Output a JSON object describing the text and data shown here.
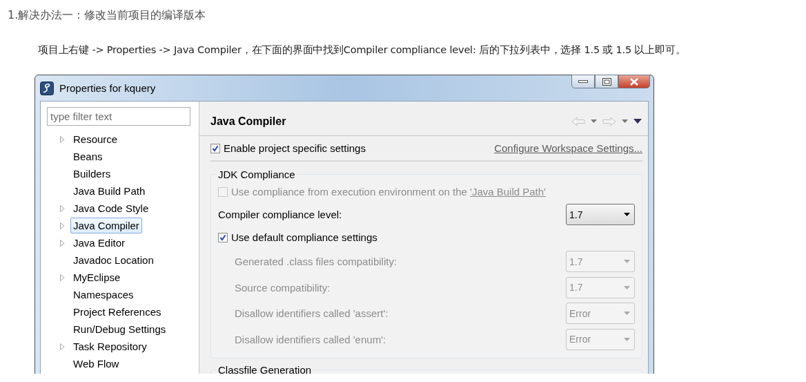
{
  "article": {
    "heading": "1.解决办法一：修改当前项目的编译版本",
    "paragraph": "项目上右键 -> Properties -> Java Compiler，在下面的界面中找到Compiler compliance level: 后的下拉列表中，选择 1.5 或 1.5 以上即可。"
  },
  "dialog": {
    "title": "Properties for kquery",
    "filter": {
      "placeholder": "type filter text"
    },
    "tree": [
      {
        "label": "Resource",
        "expandable": true,
        "selected": false
      },
      {
        "label": "Beans",
        "expandable": false,
        "selected": false
      },
      {
        "label": "Builders",
        "expandable": false,
        "selected": false
      },
      {
        "label": "Java Build Path",
        "expandable": false,
        "selected": false
      },
      {
        "label": "Java Code Style",
        "expandable": true,
        "selected": false
      },
      {
        "label": "Java Compiler",
        "expandable": true,
        "selected": true
      },
      {
        "label": "Java Editor",
        "expandable": true,
        "selected": false
      },
      {
        "label": "Javadoc Location",
        "expandable": false,
        "selected": false
      },
      {
        "label": "MyEclipse",
        "expandable": true,
        "selected": false
      },
      {
        "label": "Namespaces",
        "expandable": false,
        "selected": false
      },
      {
        "label": "Project References",
        "expandable": false,
        "selected": false
      },
      {
        "label": "Run/Debug Settings",
        "expandable": false,
        "selected": false
      },
      {
        "label": "Task Repository",
        "expandable": true,
        "selected": false
      },
      {
        "label": "Web Flow",
        "expandable": false,
        "selected": false
      }
    ],
    "page_title": "Java Compiler",
    "enable_specific": {
      "label": "Enable project specific settings",
      "checked": true
    },
    "workspace_link": "Configure Workspace Settings...",
    "jdk_group": {
      "title": "JDK Compliance",
      "use_ee": {
        "label": "Use compliance from execution environment on the",
        "link": "'Java Build Path'",
        "checked": false,
        "disabled": true
      },
      "compliance_level": {
        "label": "Compiler compliance level:",
        "value": "1.7"
      },
      "use_default": {
        "label": "Use default compliance settings",
        "checked": true
      },
      "settings": [
        {
          "label": "Generated .class files compatibility:",
          "value": "1.7",
          "disabled": true
        },
        {
          "label": "Source compatibility:",
          "value": "1.7",
          "disabled": true
        },
        {
          "label": "Disallow identifiers called 'assert':",
          "value": "Error",
          "disabled": true
        },
        {
          "label": "Disallow identifiers called 'enum':",
          "value": "Error",
          "disabled": true
        }
      ]
    },
    "next_group": {
      "title": "Classfile Generation"
    }
  }
}
